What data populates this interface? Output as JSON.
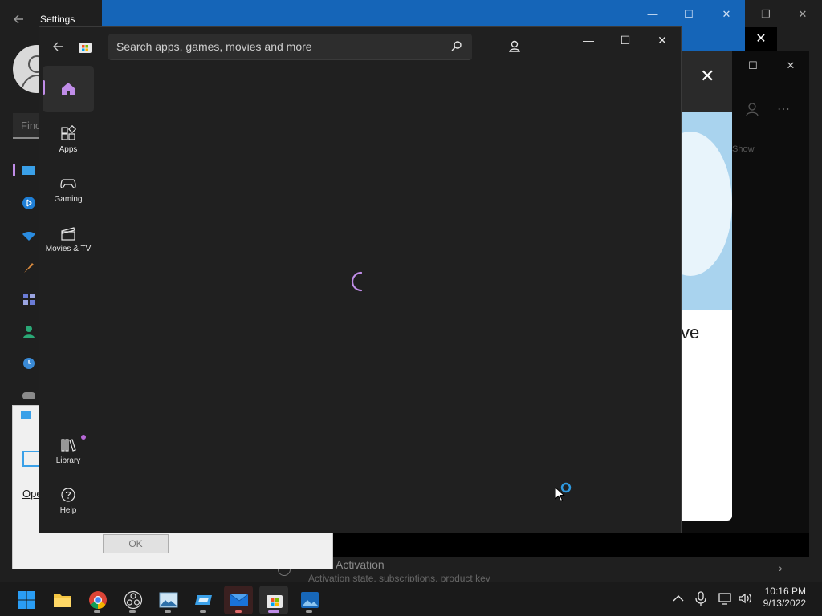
{
  "settings": {
    "title": "Settings",
    "find_placeholder": "Find",
    "activation_title": "Activation",
    "activation_subtitle": "Activation state, subscriptions, product key"
  },
  "right_window": {
    "partial_heading": "ve",
    "show_label": "Show"
  },
  "white_dialog": {
    "open_link": "Ope",
    "ok_label": "OK"
  },
  "store": {
    "search_placeholder": "Search apps, games, movies and more",
    "nav": [
      {
        "label": "Home",
        "icon": "home-icon"
      },
      {
        "label": "Apps",
        "icon": "apps-icon"
      },
      {
        "label": "Gaming",
        "icon": "gaming-icon"
      },
      {
        "label": "Movies & TV",
        "icon": "movies-icon"
      }
    ],
    "bottom_nav": [
      {
        "label": "Library",
        "icon": "library-icon"
      },
      {
        "label": "Help",
        "icon": "help-icon"
      }
    ],
    "accent": "#c08de8"
  },
  "taskbar": {
    "apps": [
      "start-icon",
      "file-explorer-icon",
      "chrome-icon",
      "obs-icon",
      "photos-icon",
      "windows-security-icon",
      "mail-icon",
      "microsoft-store-icon",
      "photos-viewer-icon"
    ],
    "time": "10:16 PM",
    "date": "9/13/2022"
  }
}
